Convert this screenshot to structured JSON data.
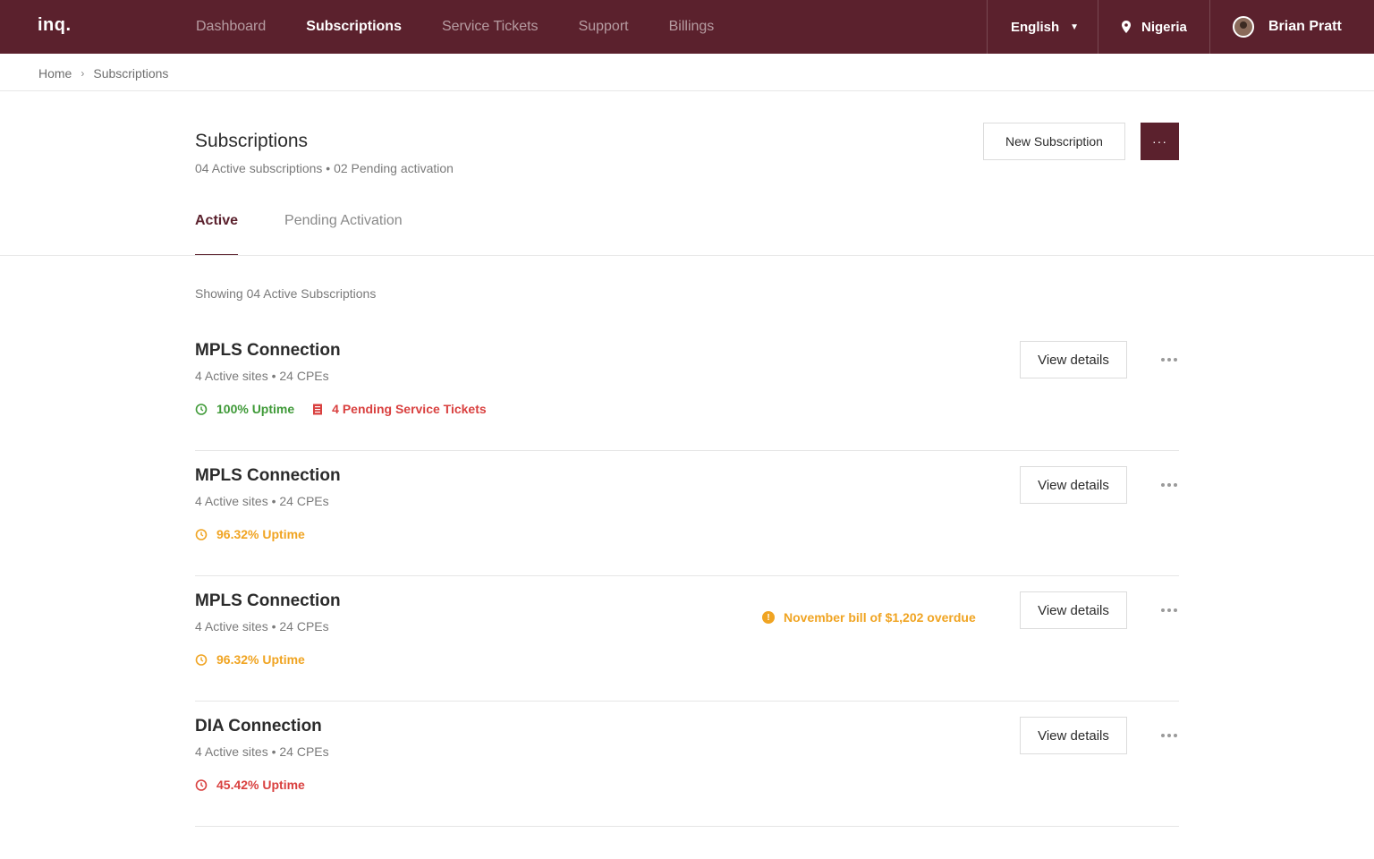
{
  "app": {
    "logo": "inq."
  },
  "nav": {
    "items": [
      {
        "label": "Dashboard",
        "active": false
      },
      {
        "label": "Subscriptions",
        "active": true
      },
      {
        "label": "Service Tickets",
        "active": false
      },
      {
        "label": "Support",
        "active": false
      },
      {
        "label": "Billings",
        "active": false
      }
    ],
    "language": "English",
    "country": "Nigeria",
    "user": "Brian Pratt"
  },
  "breadcrumb": {
    "home": "Home",
    "current": "Subscriptions"
  },
  "header": {
    "title": "Subscriptions",
    "subtitle": "04 Active subscriptions • 02 Pending activation",
    "new_button": "New Subscription",
    "more_button": "···"
  },
  "tabs": [
    {
      "label": "Active",
      "active": true
    },
    {
      "label": "Pending Activation",
      "active": false
    }
  ],
  "list": {
    "showing": "Showing 04 Active Subscriptions",
    "view_label": "View details",
    "rows": [
      {
        "name": "MPLS Connection",
        "meta": "4 Active sites • 24 CPEs",
        "uptime": "100% Uptime",
        "uptime_status": "green",
        "tickets": "4 Pending Service Tickets",
        "alert": ""
      },
      {
        "name": "MPLS Connection",
        "meta": "4 Active sites • 24 CPEs",
        "uptime": "96.32% Uptime",
        "uptime_status": "orange",
        "tickets": "",
        "alert": ""
      },
      {
        "name": "MPLS Connection",
        "meta": "4 Active sites • 24 CPEs",
        "uptime": "96.32% Uptime",
        "uptime_status": "orange",
        "tickets": "",
        "alert": "November bill of $1,202 overdue"
      },
      {
        "name": "DIA Connection",
        "meta": "4 Active sites • 24 CPEs",
        "uptime": "45.42% Uptime",
        "uptime_status": "red",
        "tickets": "",
        "alert": ""
      }
    ]
  },
  "colors": {
    "brand": "#5b212d",
    "green": "#3f9a38",
    "orange": "#f0a422",
    "red": "#d9403f"
  }
}
